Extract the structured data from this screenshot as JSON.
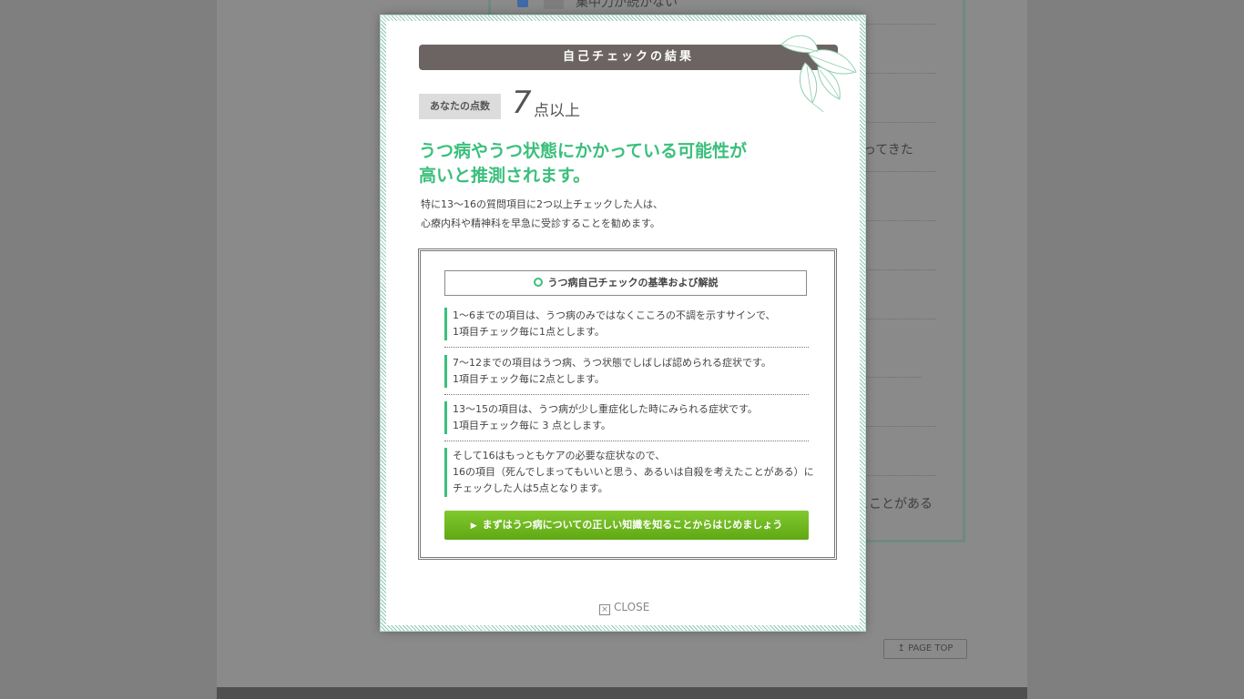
{
  "background": {
    "top_item": "集中力が続かない",
    "partial_text_1": "ってきた",
    "partial_text_2": "とことがある",
    "page_top": "PAGE TOP"
  },
  "modal": {
    "title": "自己チェックの結果",
    "score_label": "あなたの点数",
    "score_value": "7",
    "score_unit": "点以上",
    "headline_1": "うつ病やうつ状態にかかっている可能性が",
    "headline_2": "高いと推測されます。",
    "desc_1": "特に13〜16の質問項目に2つ以上チェックした人は、",
    "desc_2": "心療内科や精神科を早急に受診することを勧めます。",
    "criteria_title": "うつ病自己チェックの基準および解説",
    "items": [
      {
        "line1": "1〜6までの項目は、うつ病のみではなくこころの不調を示すサインで、",
        "line2": "1項目チェック毎に1点とします。"
      },
      {
        "line1": "7〜12までの項目はうつ病、うつ状態でしばしば認められる症状です。",
        "line2": "1項目チェック毎に2点とします。"
      },
      {
        "line1": "13〜15の項目は、うつ病が少し重症化した時にみられる症状です。",
        "line2": "1項目チェック毎に 3 点とします。"
      },
      {
        "line1": "そして16はもっともケアの必要な症状なので、",
        "line2": "16の項目（死んでしまってもいいと思う、あるいは自殺を考えたことがある）に",
        "line3": "チェックした人は5点となります。"
      }
    ],
    "cta_label": "まずはうつ病についての正しい知識を知ることからはじめましょう",
    "close_label": "CLOSE"
  },
  "colors": {
    "accent_green": "#3bbf7c",
    "title_bar": "#6b6462",
    "cta_green": "#6fb820"
  }
}
